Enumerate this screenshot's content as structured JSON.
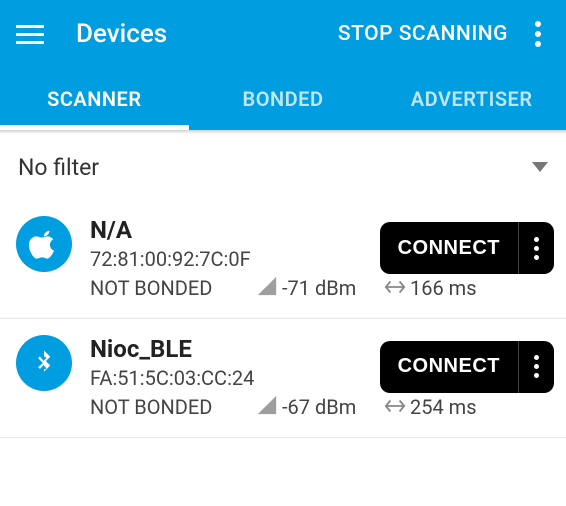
{
  "header": {
    "title": "Devices",
    "stop_scanning": "STOP SCANNING"
  },
  "tabs": [
    {
      "label": "SCANNER",
      "active": true
    },
    {
      "label": "BONDED",
      "active": false
    },
    {
      "label": "ADVERTISER",
      "active": false
    }
  ],
  "filter": {
    "label": "No filter"
  },
  "devices": [
    {
      "icon": "apple",
      "name": "N/A",
      "address": "72:81:00:92:7C:0F",
      "bond": "NOT BONDED",
      "rssi": "-71 dBm",
      "interval": "166 ms",
      "connect": "CONNECT"
    },
    {
      "icon": "bluetooth",
      "name": "Nioc_BLE",
      "address": "FA:51:5C:03:CC:24",
      "bond": "NOT BONDED",
      "rssi": "-67 dBm",
      "interval": "254 ms",
      "connect": "CONNECT"
    }
  ]
}
